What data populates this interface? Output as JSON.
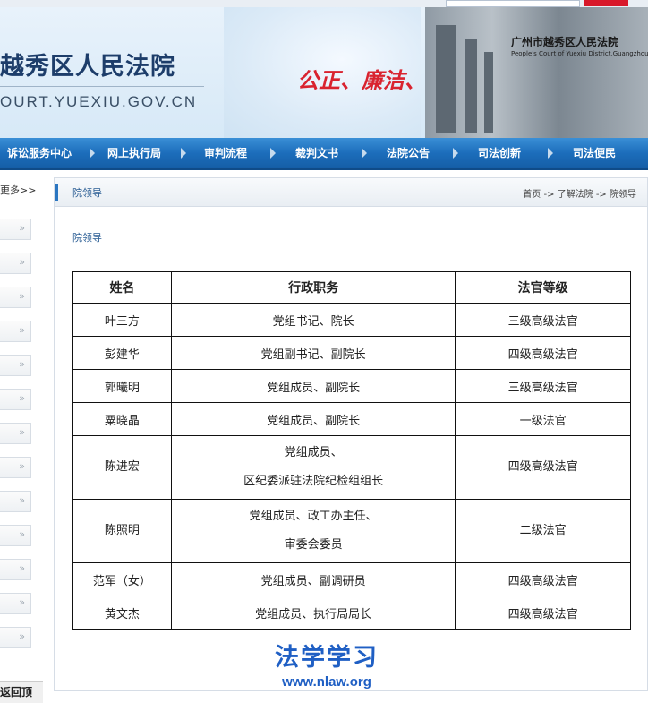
{
  "header": {
    "site_name": "越秀区人民法院",
    "site_url": "OURT.YUEXIU.GOV.CN",
    "slogan": "公正、廉洁、高效",
    "building_sign": "广州市越秀区人民法院",
    "building_sign_en": "People's Court of Yuexiu District,Guangzhou"
  },
  "nav": {
    "items": [
      {
        "label": "诉讼服务中心"
      },
      {
        "label": "网上执行局"
      },
      {
        "label": "审判流程"
      },
      {
        "label": "裁判文书"
      },
      {
        "label": "法院公告"
      },
      {
        "label": "司法创新"
      },
      {
        "label": "司法便民"
      }
    ]
  },
  "sidebar": {
    "more_label": "更多>>",
    "chevron": "»",
    "item_count": 13,
    "footer_label": "返回顶"
  },
  "panel": {
    "title": "院领导",
    "breadcrumb": "首页 -> 了解法院 -> 院领导",
    "heading": "院领导"
  },
  "table": {
    "headers": [
      "姓名",
      "行政职务",
      "法官等级"
    ],
    "rows": [
      {
        "name": "叶三方",
        "position": [
          "党组书记、院长"
        ],
        "grade": "三级高级法官"
      },
      {
        "name": "彭建华",
        "position": [
          "党组副书记、副院长"
        ],
        "grade": "四级高级法官"
      },
      {
        "name": "郭曦明",
        "position": [
          "党组成员、副院长"
        ],
        "grade": "三级高级法官"
      },
      {
        "name": "粟晓晶",
        "position": [
          "党组成员、副院长"
        ],
        "grade": "一级法官"
      },
      {
        "name": "陈进宏",
        "position": [
          "党组成员、",
          "区纪委派驻法院纪检组组长"
        ],
        "grade": "四级高级法官"
      },
      {
        "name": "陈照明",
        "position": [
          "党组成员、政工办主任、",
          "审委会委员"
        ],
        "grade": "二级法官"
      },
      {
        "name": "范军（女）",
        "position": [
          "党组成员、副调研员"
        ],
        "grade": "四级高级法官"
      },
      {
        "name": "黄文杰",
        "position": [
          "党组成员、执行局局长"
        ],
        "grade": "四级高级法官"
      }
    ]
  },
  "watermark": {
    "main": "法学学习",
    "url": "www.nlaw.org"
  },
  "colors": {
    "nav_blue": "#1c6dbb",
    "accent_blue": "#2b76c1",
    "slogan_red": "#d9232f",
    "watermark_blue": "#1f5fc4"
  }
}
